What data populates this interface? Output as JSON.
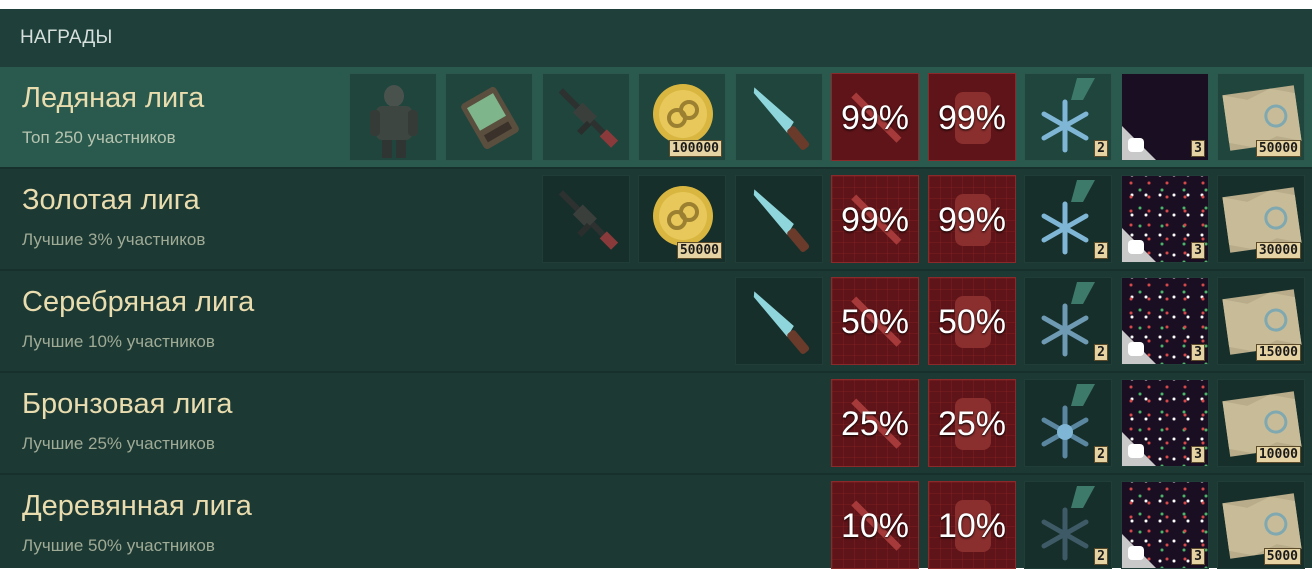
{
  "header": {
    "title": "НАГРАДЫ"
  },
  "leagues": [
    {
      "name": "Ледяная лига",
      "condition": "Топ 250 участников",
      "items": [
        {
          "id": "armor-icon"
        },
        {
          "id": "device-icon"
        },
        {
          "id": "rifle-icon"
        },
        {
          "id": "coin-icon",
          "badge": "100000"
        },
        {
          "id": "knife-icon"
        },
        {
          "id": "booster-weapon",
          "percent": "99%"
        },
        {
          "id": "booster-armor",
          "percent": "99%"
        },
        {
          "id": "medal-icon",
          "badge": "2"
        },
        {
          "id": "pattern-icon",
          "badge": "3"
        },
        {
          "id": "map-icon",
          "badge": "50000"
        }
      ]
    },
    {
      "name": "Золотая лига",
      "condition": "Лучшие 3% участников",
      "items": [
        {
          "id": "rifle-icon"
        },
        {
          "id": "coin-icon",
          "badge": "50000"
        },
        {
          "id": "knife-icon"
        },
        {
          "id": "booster-weapon",
          "percent": "99%"
        },
        {
          "id": "booster-armor",
          "percent": "99%"
        },
        {
          "id": "medal-icon",
          "badge": "2"
        },
        {
          "id": "pattern-icon",
          "badge": "3"
        },
        {
          "id": "map-icon",
          "badge": "30000"
        }
      ]
    },
    {
      "name": "Серебряная лига",
      "condition": "Лучшие 10% участников",
      "items": [
        {
          "id": "knife-icon"
        },
        {
          "id": "booster-weapon",
          "percent": "50%"
        },
        {
          "id": "booster-armor",
          "percent": "50%"
        },
        {
          "id": "medal-icon",
          "badge": "2"
        },
        {
          "id": "pattern-icon",
          "badge": "3"
        },
        {
          "id": "map-icon",
          "badge": "15000"
        }
      ]
    },
    {
      "name": "Бронзовая лига",
      "condition": "Лучшие 25% участников",
      "items": [
        {
          "id": "booster-weapon",
          "percent": "25%"
        },
        {
          "id": "booster-armor",
          "percent": "25%"
        },
        {
          "id": "medal-icon",
          "badge": "2"
        },
        {
          "id": "pattern-icon",
          "badge": "3"
        },
        {
          "id": "map-icon",
          "badge": "10000"
        }
      ]
    },
    {
      "name": "Деревянная лига",
      "condition": "Лучшие 50% участников",
      "items": [
        {
          "id": "booster-weapon",
          "percent": "10%"
        },
        {
          "id": "booster-armor",
          "percent": "10%"
        },
        {
          "id": "medal-icon",
          "badge": "2"
        },
        {
          "id": "pattern-icon",
          "badge": "3"
        },
        {
          "id": "map-icon",
          "badge": "5000"
        }
      ]
    }
  ],
  "colors": {
    "panel": "#1e3a35",
    "active_row": "#2a5a4e",
    "league_title": "#e9dcae",
    "booster": "#5e1418",
    "badge": "#e6d3a3"
  }
}
